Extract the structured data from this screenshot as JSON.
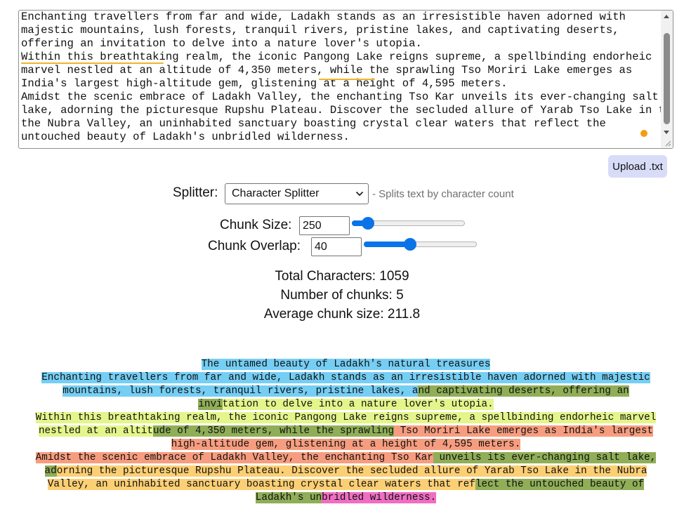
{
  "editor": {
    "lines": [
      "Enchanting travellers from far and wide, Ladakh stands as an irresistible haven adorned with",
      "majestic mountains, lush forests, tranquil rivers, pristine lakes, and captivating deserts,",
      "offering an invitation to delve into a nature lover's utopia.",
      "Within this breathtaking realm, the iconic Pangong Lake reigns supreme, a spellbinding endorheic",
      "marvel nestled at an altitude of 4,350 meters, while the sprawling Tso Moriri Lake emerges as",
      "India's largest high-altitude gem, glistening at a height of 4,595 meters.",
      "Amidst the scenic embrace of Ladakh Valley, the enchanting Tso Kar unveils its ever-changing salt",
      "lake, adorning the picturesque Rupshu Plateau. Discover the secluded allure of Yarab Tso Lake in the",
      "the Nubra Valley, an uninhabited sanctuary boasting crystal clear waters that reflect the",
      "untouched beauty of Ladakh's unbridled wilderness."
    ]
  },
  "upload_label": "Upload .txt",
  "splitter": {
    "label": "Splitter:",
    "selected": "Character Splitter",
    "description": "- Splits text by character count"
  },
  "chunk_size": {
    "label": "Chunk Size:",
    "value": "250",
    "slider_fraction": 0.1
  },
  "chunk_overlap": {
    "label": "Chunk Overlap:",
    "value": "40",
    "slider_fraction": 0.4
  },
  "stats": {
    "total": "Total Characters: 1059",
    "count": "Number of chunks: 5",
    "average": "Average chunk size: 211.8"
  },
  "chunks": {
    "l1": [
      "The untamed beauty of Ladakh's natural treasures"
    ],
    "l2": [
      "Enchanting travellers from far and wide, Ladakh stands as an irresistible haven adorned with majestic"
    ],
    "l3": [
      "mountains, lush forests, tranquil rivers, pristine lakes, a",
      "nd captivating deserts, offering an"
    ],
    "l4": [
      "invi",
      "tation to delve into a nature lover's utopia."
    ],
    "l5": [
      "Within this breathtaking realm, the iconic Pangong Lake reigns supreme, a spellbinding endorheic marvel"
    ],
    "l6": [
      "nestled at an altit",
      "ude of 4,350 meters, while the sprawling",
      " Tso Moriri Lake emerges as India's largest"
    ],
    "l7": [
      "high-altitude gem, glistening at a height of 4,595 meters."
    ],
    "l8": [
      "Amidst the scenic embrace of Ladakh Valley, the enchanting Tso Kar",
      " unveils its ever-changing salt lake,"
    ],
    "l9": [
      "ad",
      "orning the picturesque Rupshu Plateau. Discover the secluded allure of Yarab Tso Lake in the Nubra"
    ],
    "l10": [
      "Valley, an uninhabited sanctuary boasting crystal clear waters that ref",
      "lect the untouched beauty of"
    ],
    "l11": [
      "Ladakh's un",
      "bridled wilderness."
    ]
  }
}
